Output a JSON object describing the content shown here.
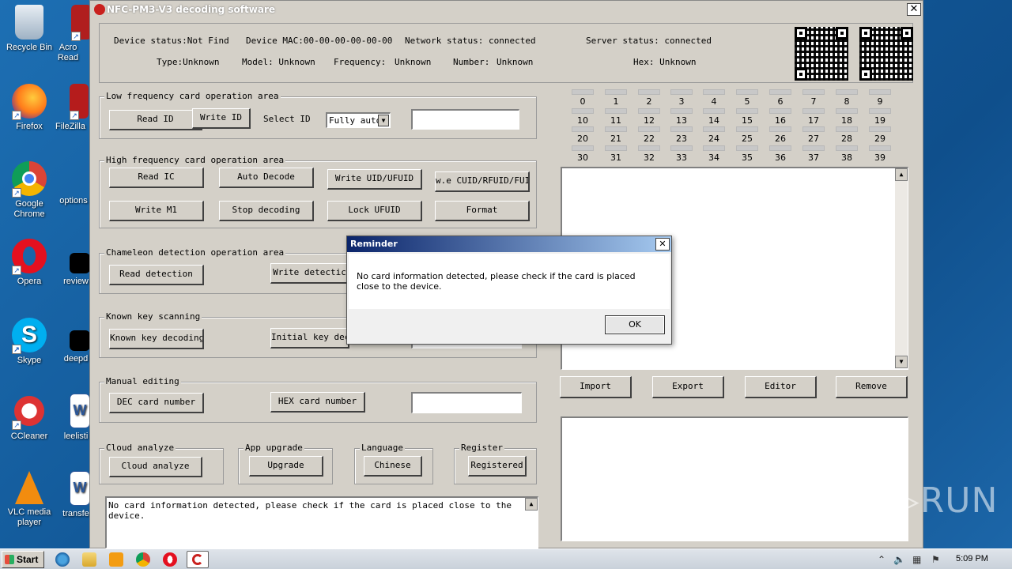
{
  "desktop": {
    "icons": [
      {
        "label": "Recycle Bin",
        "name": "recycle-bin-icon"
      },
      {
        "label": "Acro Read",
        "name": "acrobat-reader-icon"
      },
      {
        "label": "Firefox",
        "name": "firefox-icon"
      },
      {
        "label": "FileZilla",
        "name": "filezilla-icon"
      },
      {
        "label": "Google Chrome",
        "name": "chrome-icon"
      },
      {
        "label": "options",
        "name": "file-icon"
      },
      {
        "label": "Opera",
        "name": "opera-icon"
      },
      {
        "label": "review",
        "name": "file-icon"
      },
      {
        "label": "Skype",
        "name": "skype-icon"
      },
      {
        "label": "deepd",
        "name": "file-icon"
      },
      {
        "label": "CCleaner",
        "name": "ccleaner-icon"
      },
      {
        "label": "leelisti",
        "name": "word-doc-icon"
      },
      {
        "label": "VLC media player",
        "name": "vlc-icon"
      },
      {
        "label": "transfe",
        "name": "word-doc-icon"
      }
    ]
  },
  "window": {
    "title": "NFC-PM3-V3 decoding software",
    "close_label": "✕"
  },
  "info": {
    "device_status": "Device status:Not Find",
    "device_mac": "Device MAC:00-00-00-00-00-00",
    "network_status": "Network status: connected",
    "server_status": "Server status: connected",
    "type": "Type:Unknown",
    "model": "Model: Unknown",
    "frequency": "Frequency:",
    "frequency_value": "Unknown",
    "number": "Number:",
    "number_value": "Unknown",
    "hex": "Hex: Unknown"
  },
  "low_freq": {
    "legend": "Low frequency card operation area",
    "read_id": "Read ID",
    "write_id": "Write ID",
    "select_id_label": "Select ID",
    "select_value": "Fully auto",
    "dropdown_arrow": "▼",
    "input_value": ""
  },
  "high_freq": {
    "legend": "High frequency card operation area",
    "read_ic": "Read IC",
    "auto_decode": "Auto Decode",
    "write_uid": "Write UID/UFUID",
    "write_cuid": "w.e CUID/RFUID/FUID",
    "write_m1": "Write M1",
    "stop_decoding": "Stop decoding",
    "lock_ufuid": "Lock UFUID",
    "format": "Format"
  },
  "chameleon": {
    "legend": "Chameleon detection operation area",
    "read_detection": "Read detection",
    "write_detection": "Write detectic"
  },
  "known_key": {
    "legend": "Known key scanning",
    "known_key_decoding": "Known key decoding",
    "initial_key": "Initial key deco"
  },
  "manual": {
    "legend": "Manual editing",
    "dec_card": "DEC card number",
    "hex_card": "HEX card number",
    "input_value": ""
  },
  "cloud": {
    "legend": "Cloud analyze",
    "button": "Cloud analyze"
  },
  "app_upgrade": {
    "legend": "App upgrade",
    "button": "Upgrade"
  },
  "language": {
    "legend": "Language",
    "button": "Chinese"
  },
  "register": {
    "legend": "Register",
    "button": "Registered"
  },
  "log": {
    "text": "No card information detected, please check if the card is placed close to the device.",
    "scroll_up": "▲"
  },
  "grid_numbers": [
    "0",
    "1",
    "2",
    "3",
    "4",
    "5",
    "6",
    "7",
    "8",
    "9",
    "10",
    "11",
    "12",
    "13",
    "14",
    "15",
    "16",
    "17",
    "18",
    "19",
    "20",
    "21",
    "22",
    "23",
    "24",
    "25",
    "26",
    "27",
    "28",
    "29",
    "30",
    "31",
    "32",
    "33",
    "34",
    "35",
    "36",
    "37",
    "38",
    "39"
  ],
  "right_panel": {
    "scroll_up": "▲",
    "scroll_down": "▼",
    "import": "Import",
    "export": "Export",
    "editor": "Editor",
    "remove": "Remove"
  },
  "dialog": {
    "title": "Reminder",
    "message": "No card information detected, please check if the card is placed close to the device.",
    "ok": "OK",
    "close": "✕"
  },
  "taskbar": {
    "start": "Start",
    "time": "5:09 PM",
    "tray_up": "⌃"
  },
  "watermark": "ANY▷RUN"
}
